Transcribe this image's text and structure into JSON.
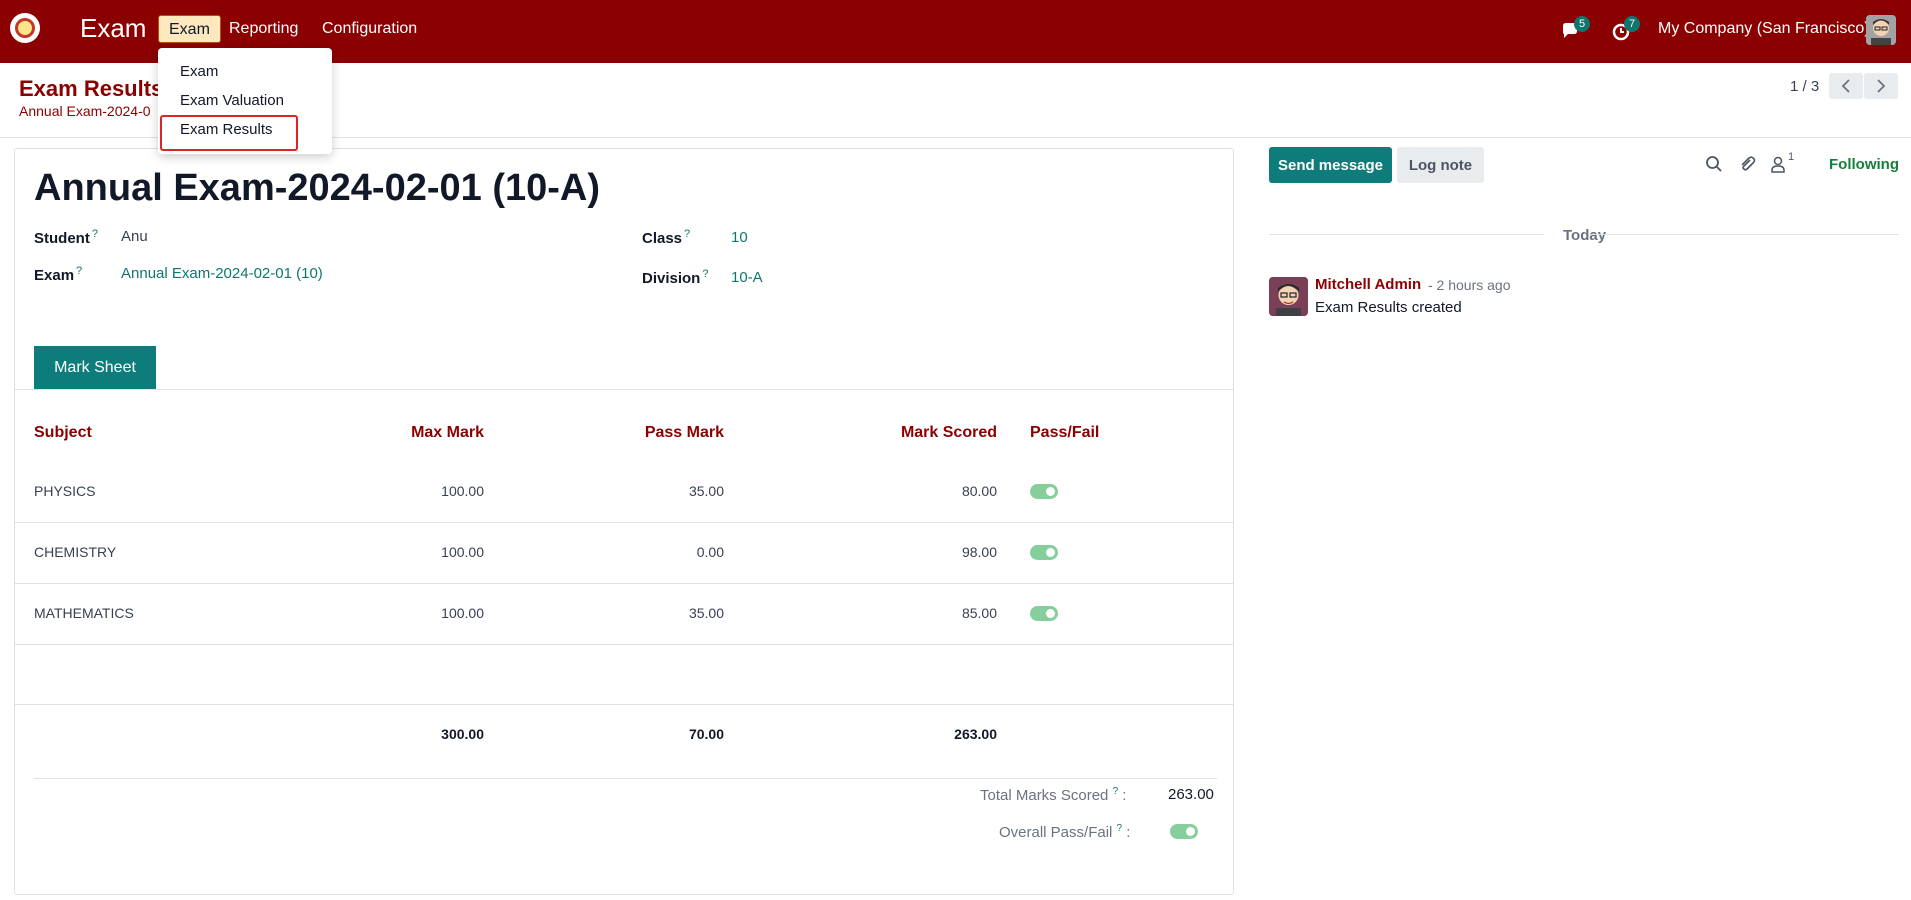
{
  "navbar": {
    "app_name": "Exam",
    "menus": [
      "Exam",
      "Reporting",
      "Configuration"
    ],
    "messages_count": "5",
    "activities_count": "7",
    "company": "My Company (San Francisco)"
  },
  "dropdown": {
    "items": [
      "Exam",
      "Exam Valuation",
      "Exam Results"
    ]
  },
  "breadcrumb": {
    "title": "Exam Results",
    "subtitle": "Annual Exam-2024-0"
  },
  "pager": {
    "text": "1 / 3"
  },
  "form": {
    "title": "Annual Exam-2024-02-01 (10-A)",
    "fields": {
      "student_label": "Student",
      "student_value": "Anu",
      "exam_label": "Exam",
      "exam_value": "Annual Exam-2024-02-01 (10)",
      "class_label": "Class",
      "class_value": "10",
      "division_label": "Division",
      "division_value": "10-A",
      "help_mark": "?"
    },
    "tab_label": "Mark Sheet",
    "table": {
      "headers": [
        "Subject",
        "Max Mark",
        "Pass Mark",
        "Mark Scored",
        "Pass/Fail"
      ],
      "rows": [
        {
          "subject": "PHYSICS",
          "max": "100.00",
          "pass": "35.00",
          "scored": "80.00",
          "passed": true
        },
        {
          "subject": "CHEMISTRY",
          "max": "100.00",
          "pass": "0.00",
          "scored": "98.00",
          "passed": true
        },
        {
          "subject": "MATHEMATICS",
          "max": "100.00",
          "pass": "35.00",
          "scored": "85.00",
          "passed": true
        }
      ],
      "totals": {
        "max": "300.00",
        "pass": "70.00",
        "scored": "263.00"
      }
    },
    "summary": {
      "total_label": "Total Marks Scored",
      "total_value": "263.00",
      "overall_label": "Overall Pass/Fail",
      "overall_passed": true,
      "colon": ":"
    }
  },
  "chatter": {
    "send_message": "Send message",
    "log_note": "Log note",
    "followers_count": "1",
    "following": "Following",
    "date_separator": "Today",
    "message": {
      "author": "Mitchell Admin",
      "time": "- 2 hours ago",
      "body": "Exam Results created"
    }
  },
  "colors": {
    "brand": "#8b0000",
    "accent": "#0f7c7c",
    "success": "#15803d"
  }
}
